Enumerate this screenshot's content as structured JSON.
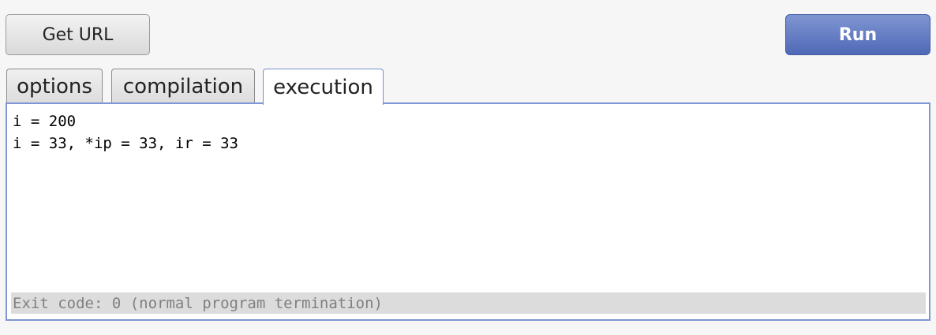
{
  "toolbar": {
    "get_url_label": "Get URL",
    "run_label": "Run"
  },
  "tabs": [
    {
      "label": "options",
      "active": false
    },
    {
      "label": "compilation",
      "active": false
    },
    {
      "label": "execution",
      "active": true
    }
  ],
  "execution": {
    "output_lines": [
      "i = 200",
      "i = 33, *ip = 33, ir = 33"
    ],
    "exit_status": "Exit code: 0 (normal program termination)"
  },
  "colors": {
    "run_button": "#5069b7",
    "panel_border": "#7e96d4",
    "exit_bar": "#dcdcdc"
  }
}
